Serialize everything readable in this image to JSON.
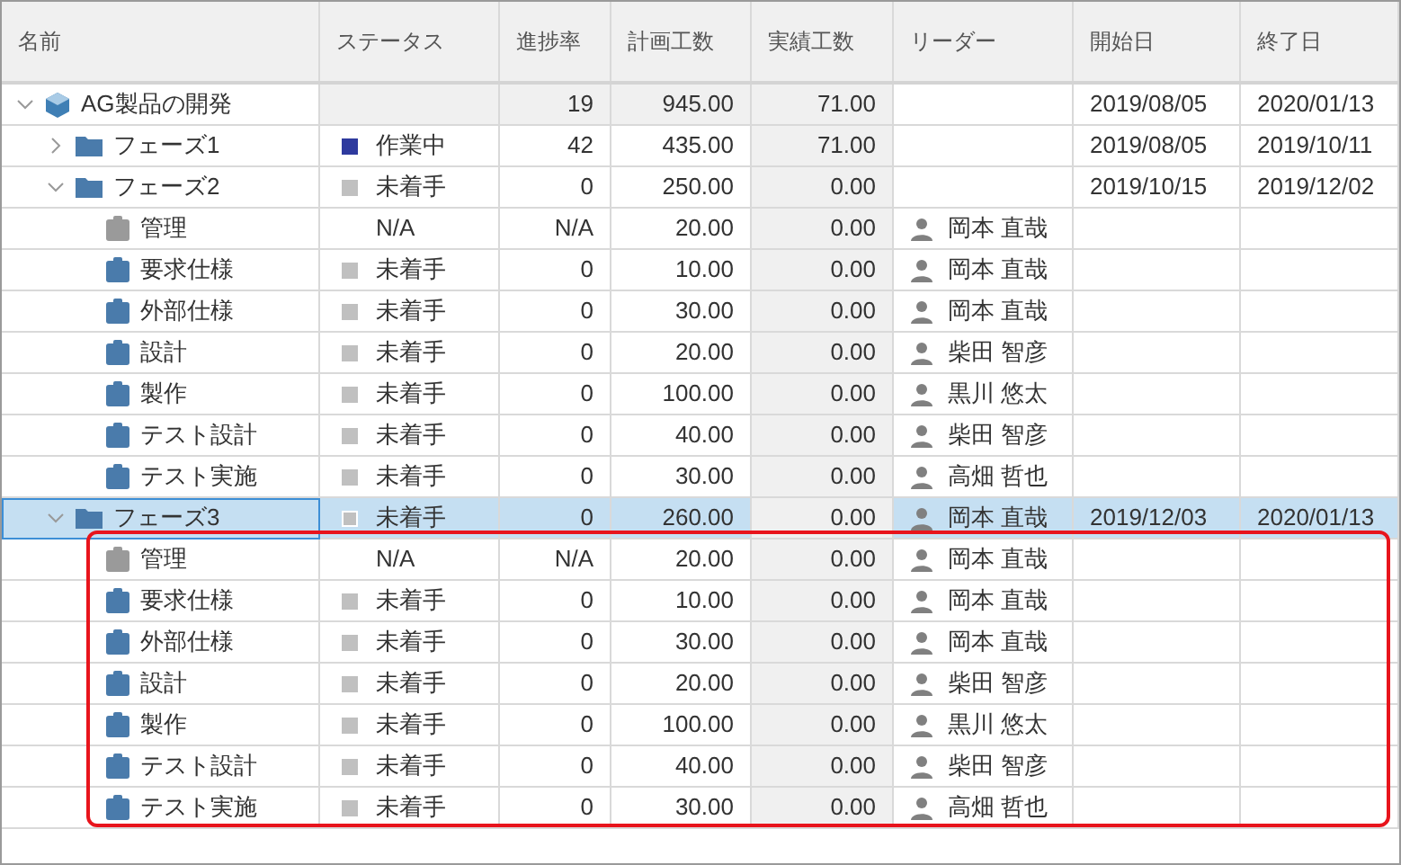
{
  "columns": [
    "名前",
    "ステータス",
    "進捗率",
    "計画工数",
    "実績工数",
    "リーダー",
    "開始日",
    "終了日"
  ],
  "rows": [
    {
      "name": "AG製品の開発",
      "kind": "project",
      "summary": true,
      "expanded": true,
      "selected": false,
      "progress": "19",
      "planned": "945.00",
      "actual": "71.00",
      "start": "2019/08/05",
      "end": "2020/01/13",
      "children": [
        {
          "name": "フェーズ1",
          "kind": "phase",
          "summary": false,
          "expanded": false,
          "selected": false,
          "status": "作業中",
          "color": "#2e3a9e",
          "progress": "42",
          "planned": "435.00",
          "actual": "71.00",
          "start": "2019/08/05",
          "end": "2019/10/11"
        },
        {
          "name": "フェーズ2",
          "kind": "phase",
          "summary": false,
          "expanded": true,
          "selected": false,
          "status": "未着手",
          "color": "#c0c0c0",
          "progress": "0",
          "planned": "250.00",
          "actual": "0.00",
          "start": "2019/10/15",
          "end": "2019/12/02",
          "children": [
            {
              "name": "管理",
              "kind": "admin",
              "summary": false,
              "selected": false,
              "status": "N/A",
              "progress": "N/A",
              "planned": "20.00",
              "actual": "0.00",
              "leader": "岡本 直哉"
            },
            {
              "name": "要求仕様",
              "kind": "task",
              "summary": false,
              "selected": false,
              "status": "未着手",
              "color": "#c0c0c0",
              "progress": "0",
              "planned": "10.00",
              "actual": "0.00",
              "leader": "岡本 直哉"
            },
            {
              "name": "外部仕様",
              "kind": "task",
              "summary": false,
              "selected": false,
              "status": "未着手",
              "color": "#c0c0c0",
              "progress": "0",
              "planned": "30.00",
              "actual": "0.00",
              "leader": "岡本 直哉"
            },
            {
              "name": "設計",
              "kind": "task",
              "summary": false,
              "selected": false,
              "status": "未着手",
              "color": "#c0c0c0",
              "progress": "0",
              "planned": "20.00",
              "actual": "0.00",
              "leader": "柴田 智彦"
            },
            {
              "name": "製作",
              "kind": "task",
              "summary": false,
              "selected": false,
              "status": "未着手",
              "color": "#c0c0c0",
              "progress": "0",
              "planned": "100.00",
              "actual": "0.00",
              "leader": "黒川 悠太"
            },
            {
              "name": "テスト設計",
              "kind": "task",
              "summary": false,
              "selected": false,
              "status": "未着手",
              "color": "#c0c0c0",
              "progress": "0",
              "planned": "40.00",
              "actual": "0.00",
              "leader": "柴田 智彦"
            },
            {
              "name": "テスト実施",
              "kind": "task",
              "summary": false,
              "selected": false,
              "status": "未着手",
              "color": "#c0c0c0",
              "progress": "0",
              "planned": "30.00",
              "actual": "0.00",
              "leader": "高畑 哲也"
            }
          ]
        },
        {
          "name": "フェーズ3",
          "kind": "phase",
          "summary": false,
          "expanded": true,
          "selected": true,
          "status": "未着手",
          "color": "#c0c0c0",
          "progress": "0",
          "planned": "260.00",
          "actual": "0.00",
          "leader": "岡本 直哉",
          "start": "2019/12/03",
          "end": "2020/01/13",
          "children": [
            {
              "name": "管理",
              "kind": "admin",
              "summary": false,
              "selected": false,
              "status": "N/A",
              "progress": "N/A",
              "planned": "20.00",
              "actual": "0.00",
              "leader": "岡本 直哉"
            },
            {
              "name": "要求仕様",
              "kind": "task",
              "summary": false,
              "selected": false,
              "status": "未着手",
              "color": "#c0c0c0",
              "progress": "0",
              "planned": "10.00",
              "actual": "0.00",
              "leader": "岡本 直哉"
            },
            {
              "name": "外部仕様",
              "kind": "task",
              "summary": false,
              "selected": false,
              "status": "未着手",
              "color": "#c0c0c0",
              "progress": "0",
              "planned": "30.00",
              "actual": "0.00",
              "leader": "岡本 直哉"
            },
            {
              "name": "設計",
              "kind": "task",
              "summary": false,
              "selected": false,
              "status": "未着手",
              "color": "#c0c0c0",
              "progress": "0",
              "planned": "20.00",
              "actual": "0.00",
              "leader": "柴田 智彦"
            },
            {
              "name": "製作",
              "kind": "task",
              "summary": false,
              "selected": false,
              "status": "未着手",
              "color": "#c0c0c0",
              "progress": "0",
              "planned": "100.00",
              "actual": "0.00",
              "leader": "黒川 悠太"
            },
            {
              "name": "テスト設計",
              "kind": "task",
              "summary": false,
              "selected": false,
              "status": "未着手",
              "color": "#c0c0c0",
              "progress": "0",
              "planned": "40.00",
              "actual": "0.00",
              "leader": "柴田 智彦"
            },
            {
              "name": "テスト実施",
              "kind": "task",
              "summary": false,
              "selected": false,
              "status": "未着手",
              "color": "#c0c0c0",
              "progress": "0",
              "planned": "30.00",
              "actual": "0.00",
              "leader": "高畑 哲也"
            }
          ]
        }
      ]
    }
  ]
}
